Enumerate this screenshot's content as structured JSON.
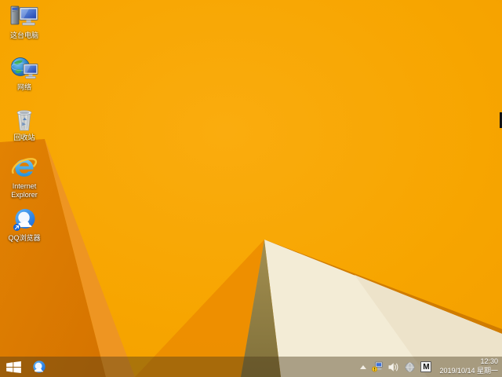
{
  "desktop": {
    "icons": [
      {
        "name": "this-pc",
        "label": "这台电脑"
      },
      {
        "name": "network",
        "label": "网络"
      },
      {
        "name": "recycle-bin",
        "label": "回收站"
      },
      {
        "name": "internet-explorer",
        "label": "Internet Explorer"
      },
      {
        "name": "qq-browser",
        "label": "QQ浏览器"
      }
    ]
  },
  "taskbar": {
    "start_icon": "windows-logo",
    "pinned": [
      {
        "name": "qq-browser"
      }
    ],
    "tray": {
      "chevron_icon": "chevron-up",
      "icons": [
        "network-warning",
        "volume",
        "safety-globe",
        "ime-mode"
      ],
      "ime_label": "M",
      "time": "12:30",
      "date": "2019/10/14 星期一"
    }
  },
  "wallpaper": {
    "base": "#F7A600",
    "base_light": "#FBAD10",
    "dark_facet": "#DC7B00",
    "fold_light": "#EE9522",
    "mid_facet": "#EC8D00",
    "olive_facet": "#9C8A4E",
    "olive_facet_dark": "#80703A",
    "cream": "#F3ECD6",
    "cream_shade": "#EDE3CA",
    "edge_stripe": "#D07C00"
  }
}
